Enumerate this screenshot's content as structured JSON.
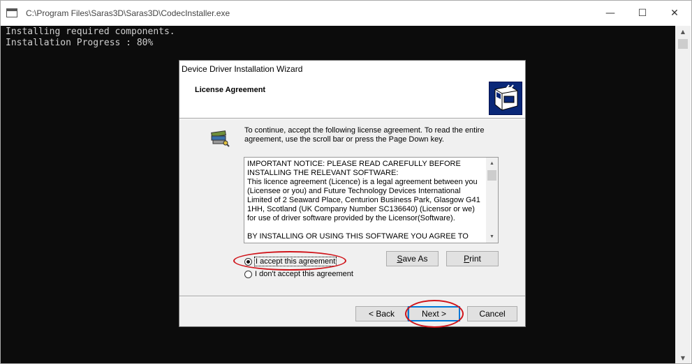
{
  "window": {
    "title": "C:\\Program Files\\Saras3D\\Saras3D\\CodecInstaller.exe",
    "minimize": "—",
    "maximize": "☐",
    "close": "✕"
  },
  "console": {
    "line1": "Installing required components.",
    "line2": "Installation Progress : 80%"
  },
  "dialog": {
    "caption": "Device Driver Installation Wizard",
    "header_title": "License Agreement",
    "intro": "To continue, accept the following license agreement. To read the entire agreement, use the scroll bar or press the Page Down key.",
    "license_p1": "IMPORTANT NOTICE: PLEASE READ CAREFULLY BEFORE INSTALLING THE RELEVANT SOFTWARE:",
    "license_p2": "This licence agreement (Licence) is a legal agreement between you (Licensee or you) and Future Technology Devices International Limited of 2 Seaward Place, Centurion Business Park, Glasgow G41 1HH, Scotland (UK Company Number SC136640) (Licensor or we) for use of driver software provided by the Licensor(Software).",
    "license_p3": "BY INSTALLING OR USING THIS SOFTWARE YOU AGREE TO THE",
    "accept_label": "I accept this agreement",
    "decline_label": "I don't accept this agreement",
    "save_as": "Save As",
    "print": "Print",
    "back": "< Back",
    "next": "Next >",
    "cancel": "Cancel"
  },
  "colors": {
    "console_bg": "#0c0c0c",
    "console_text": "#cfcfcf",
    "annotation": "#d0141a",
    "header_art": "#0a2878"
  }
}
